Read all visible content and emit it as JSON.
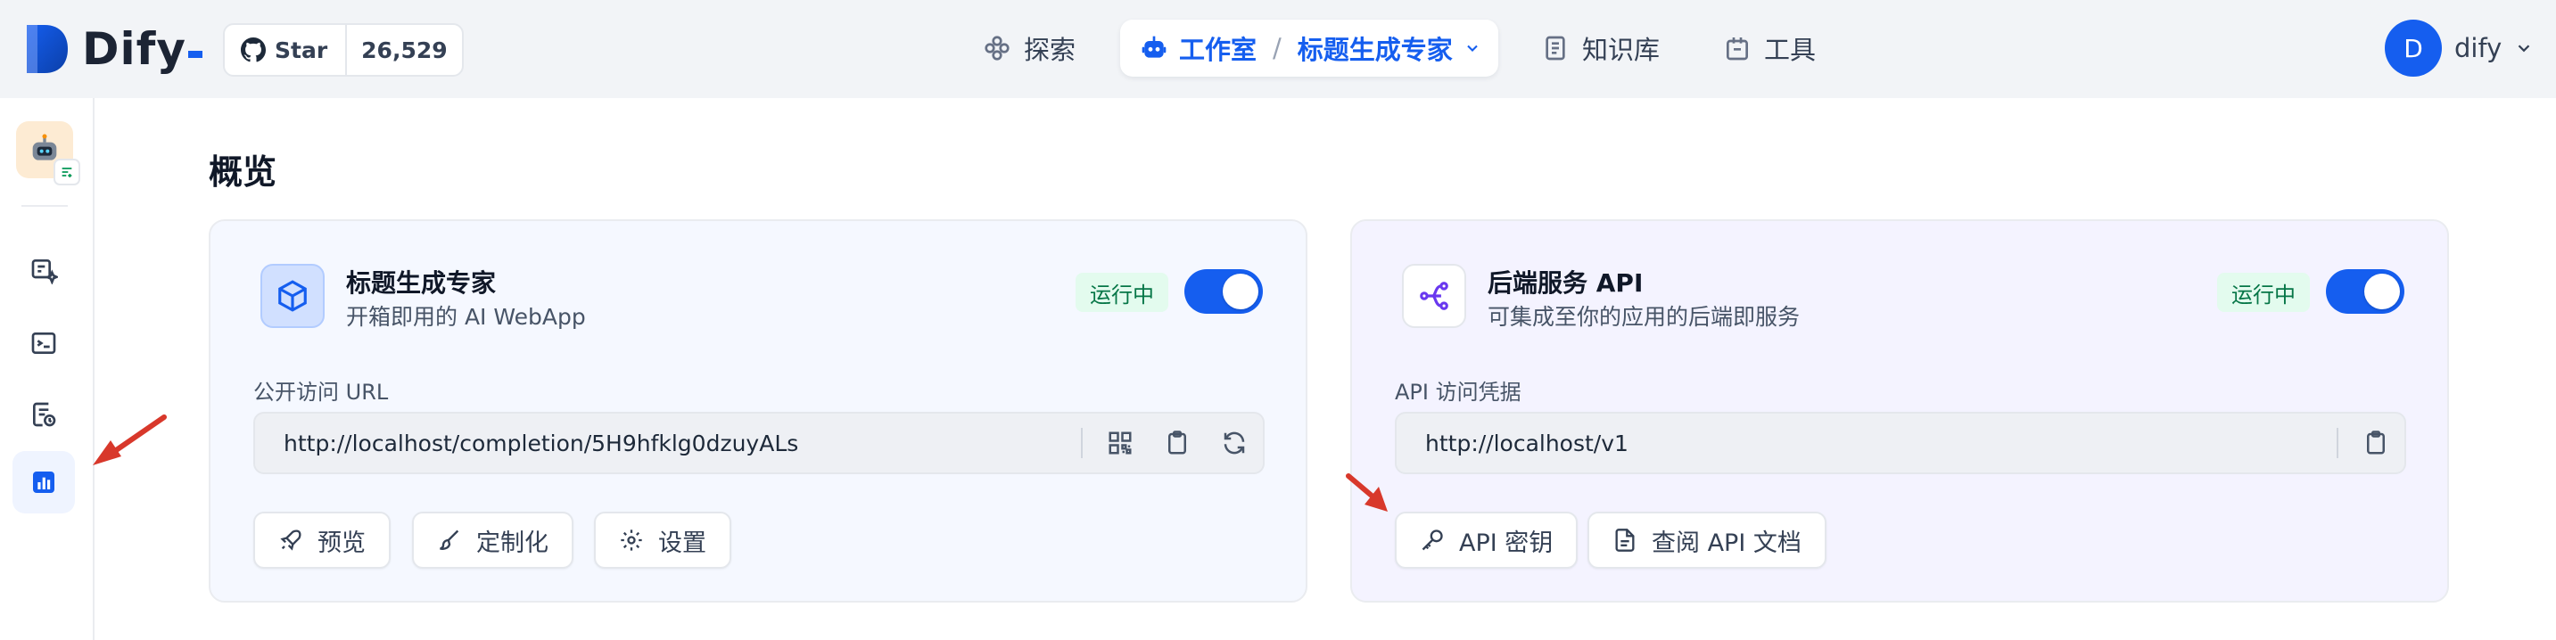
{
  "brand": {
    "name": "Dify",
    "accent": "#155eef"
  },
  "github": {
    "star_label": "Star",
    "star_count": "26,529"
  },
  "nav": {
    "explore": "探索",
    "studio": "工作室",
    "app_name": "标题生成专家",
    "knowledge": "知识库",
    "tools": "工具"
  },
  "user": {
    "initial": "D",
    "name": "dify"
  },
  "page": {
    "title": "概览"
  },
  "webapp_card": {
    "title": "标题生成专家",
    "subtitle": "开箱即用的 AI WebApp",
    "status": "运行中",
    "field_label": "公开访问 URL",
    "url": "http://localhost/completion/5H9hfklg0dzuyALs",
    "buttons": {
      "preview": "预览",
      "customize": "定制化",
      "settings": "设置"
    }
  },
  "api_card": {
    "title": "后端服务 API",
    "subtitle": "可集成至你的应用的后端即服务",
    "status": "运行中",
    "field_label": "API 访问凭据",
    "url": "http://localhost/v1",
    "buttons": {
      "api_key": "API 密钥",
      "api_docs": "查阅 API 文档"
    }
  },
  "annotation_color": "#d8382b"
}
